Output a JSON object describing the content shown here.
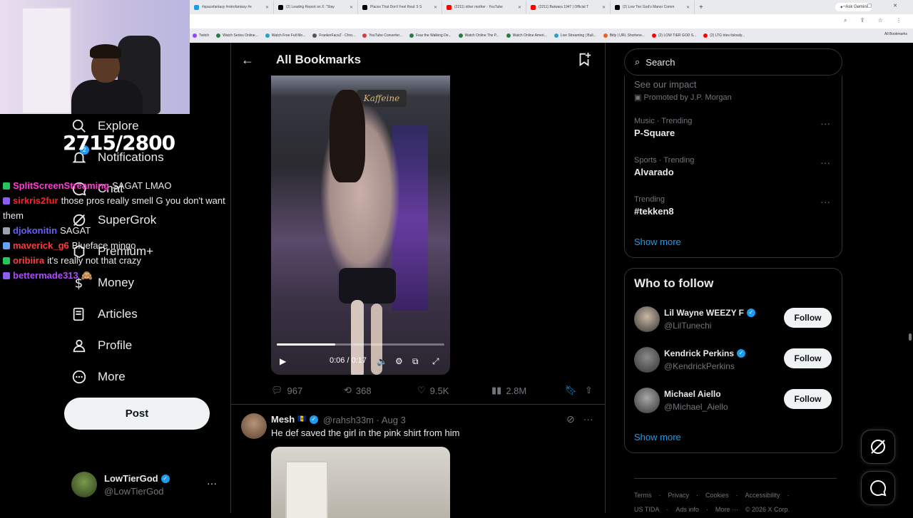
{
  "browser": {
    "tabs": [
      {
        "label": "#spacefantasy #retrofantasy #e",
        "color": "#1d9bf0"
      },
      {
        "label": "(2) Leading Report on X: \"Stay",
        "color": "#000000"
      },
      {
        "label": "Places That Don't Feel Real: 5 S",
        "color": "#000000"
      },
      {
        "label": "(2211) other mother - YouTube",
        "color": "#ff0000"
      },
      {
        "label": "(2211) Batwara 1947 | Official T",
        "color": "#ff0000"
      },
      {
        "label": "(2) Low Tier God's Manor Comm",
        "color": "#000000"
      }
    ],
    "new_tab": "+",
    "ask_gemini": "Ask Gemini",
    "window_controls": "– ▢ ✕",
    "address_icons": "⌕ ⇪ ☆ ⋮",
    "bookmarks": [
      {
        "label": "Twitch",
        "color": "#9146ff"
      },
      {
        "label": "Watch Series Online...",
        "color": "#2a7a4a"
      },
      {
        "label": "Watch Free Full Mo...",
        "color": "#2aa0c8"
      },
      {
        "label": "FrankerFaceZ - Chro...",
        "color": "#555555"
      },
      {
        "label": "YouTube Converter...",
        "color": "#d04040"
      },
      {
        "label": "Fear the Walking De...",
        "color": "#2a7a4a"
      },
      {
        "label": "Watch Online The P...",
        "color": "#2a7a4a"
      },
      {
        "label": "Watch Online Ameri...",
        "color": "#2a7a4a"
      },
      {
        "label": "Live Streaming | Bull...",
        "color": "#2aa0c8"
      },
      {
        "label": "Bitly | URL Shortene...",
        "color": "#ee6123"
      },
      {
        "label": "(2) LOW TIER GOD S...",
        "color": "#ff0000"
      },
      {
        "label": "(2) LTG tries itslowly...",
        "color": "#ff0000"
      }
    ],
    "all_bookmarks": "All Bookmarks"
  },
  "overlay": {
    "counter": "2715/2800",
    "chat": [
      {
        "user": "SplitScreenStreaming",
        "color": "#ff3fd0",
        "msg": "SAGAT LMAO"
      },
      {
        "user": "sirkris2fur",
        "color": "#ff2020",
        "msg": "those pros really smell G you don't want them"
      },
      {
        "user": "djokonitin",
        "color": "#6a5cff",
        "msg": "SAGAT"
      },
      {
        "user": "maverick_g6",
        "color": "#ff3a3a",
        "msg": "Blueface mingo"
      },
      {
        "user": "oribiira",
        "color": "#ff3a3a",
        "msg": "it's really not that crazy"
      },
      {
        "user": "bettermade313",
        "color": "#b04cff",
        "msg": "🙈"
      }
    ]
  },
  "nav": {
    "items": [
      {
        "label": "Explore",
        "icon": "search-icon"
      },
      {
        "label": "Notifications",
        "icon": "bell-icon",
        "badge": "2"
      },
      {
        "label": "Chat",
        "icon": "chat-icon"
      },
      {
        "label": "SuperGrok",
        "icon": "grok-icon"
      },
      {
        "label": "Premium+",
        "icon": "premium-icon"
      },
      {
        "label": "Money",
        "icon": "money-icon"
      },
      {
        "label": "Articles",
        "icon": "articles-icon"
      },
      {
        "label": "Profile",
        "icon": "profile-icon"
      },
      {
        "label": "More",
        "icon": "more-icon"
      }
    ],
    "post": "Post",
    "account": {
      "name": "LowTierGod",
      "handle": "@LowTierGod",
      "more": "···"
    }
  },
  "main": {
    "back": "←",
    "title": "All Bookmarks",
    "tweet1": {
      "video_sign": "Kaffeine",
      "time": "0:06 / 0:17",
      "progress": 0.35,
      "replies": "967",
      "reposts": "368",
      "likes": "9.5K",
      "views": "2.8M"
    },
    "tweet2": {
      "name": "Mesh",
      "flag": "🇧🇧",
      "handle": "@rahsh33m",
      "date": "· Aug 3",
      "text": "He def saved the girl in the pink shirt from him",
      "more": "···"
    }
  },
  "right": {
    "search_placeholder": "Search",
    "promo": {
      "title": "See our impact",
      "sub": "Promoted by J.P. Morgan"
    },
    "trends": [
      {
        "meta": "Music · Trending",
        "name": "P-Square"
      },
      {
        "meta": "Sports · Trending",
        "name": "Alvarado"
      },
      {
        "meta": "Trending",
        "name": "#tekken8"
      }
    ],
    "show_more": "Show more",
    "wtf_title": "Who to follow",
    "follow_label": "Follow",
    "who_to_follow": [
      {
        "name": "Lil Wayne WEEZY F",
        "handle": "@LilTunechi",
        "color": "#c9b8a4"
      },
      {
        "name": "Kendrick Perkins",
        "handle": "@KendrickPerkins",
        "color": "#8a8a8a"
      },
      {
        "name": "Michael Aiello",
        "handle": "@Michael_Aiello",
        "color": "#a7a7a7"
      }
    ],
    "footer1": [
      "Terms",
      "·",
      "Privacy",
      "·",
      "Cookies",
      "·",
      "Accessibility",
      "·"
    ],
    "footer2": [
      "US TIDA",
      "·",
      "Ads info",
      "·",
      "More ···",
      "© 2026 X Corp."
    ]
  },
  "colors": {
    "accent": "#1d9bf0",
    "border": "#2f3336",
    "muted": "#71767b"
  }
}
